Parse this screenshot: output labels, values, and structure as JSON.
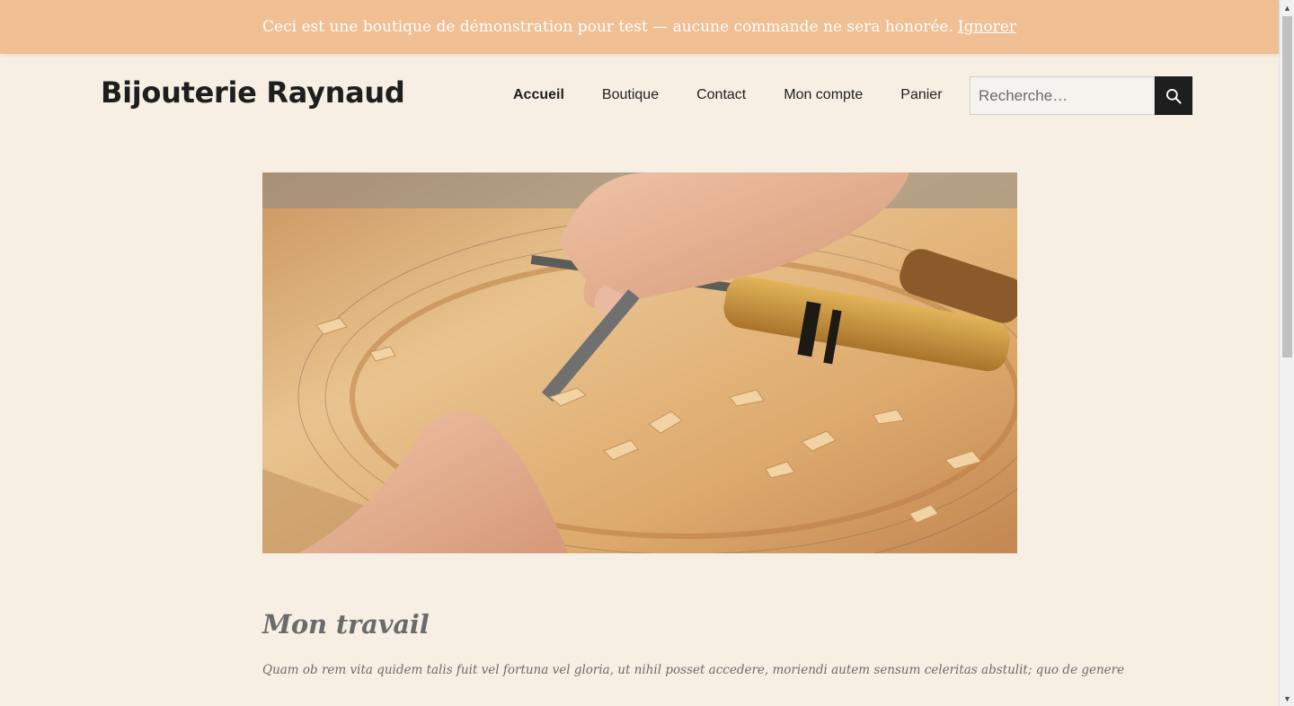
{
  "notice": {
    "text": "Ceci est une boutique de démonstration pour test — aucune commande ne sera honorée.",
    "dismiss_label": "Ignorer"
  },
  "header": {
    "site_title": "Bijouterie Raynaud",
    "nav": [
      {
        "label": "Accueil",
        "active": true
      },
      {
        "label": "Boutique"
      },
      {
        "label": "Contact"
      },
      {
        "label": "Mon compte"
      },
      {
        "label": "Panier"
      }
    ],
    "search": {
      "placeholder": "Recherche…",
      "button_icon": "search-icon"
    }
  },
  "hero": {
    "alt": "wood-carving-image"
  },
  "main": {
    "heading": "Mon travail",
    "paragraph": "Quam ob rem vita quidem talis fuit vel fortuna vel gloria, ut nihil posset accedere, moriendi autem sensum celeritas abstulit; quo de genere"
  },
  "colors": {
    "notice_bg": "#f0bf93",
    "page_bg": "#f8efe4",
    "text_dark": "#1e1e1e",
    "text_muted": "#6b6b6b"
  }
}
